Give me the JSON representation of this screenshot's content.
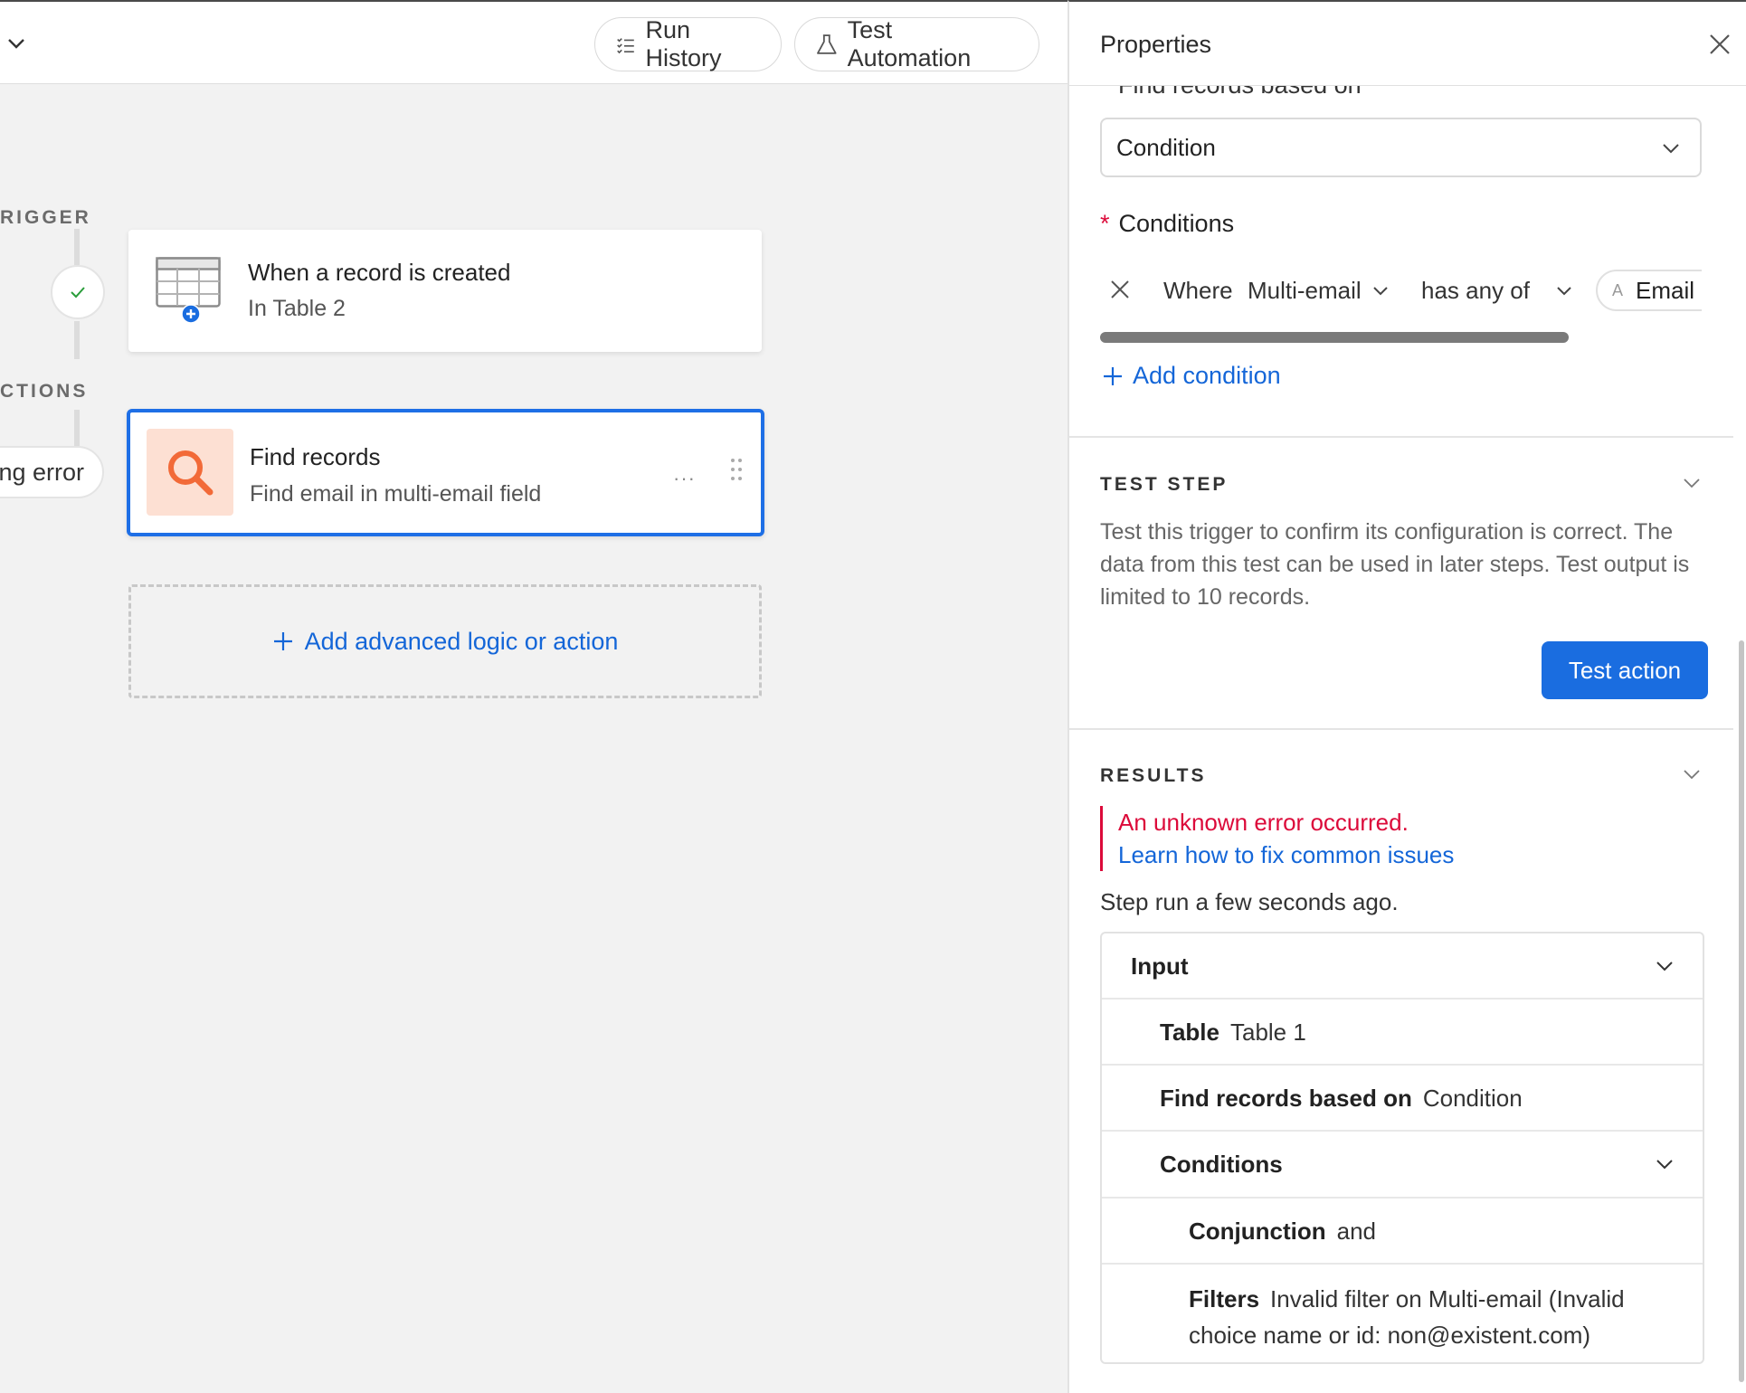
{
  "toolbar": {
    "run_history": "Run History",
    "test_automation": "Test Automation"
  },
  "canvas": {
    "trigger_label": "RIGGER",
    "actions_label": "CTIONS",
    "error_pill": "ng error",
    "trigger_card": {
      "title": "When a record is created",
      "subtitle": "In Table 2"
    },
    "action_card": {
      "title": "Find records",
      "subtitle": "Find email in multi-email field",
      "more": "···"
    },
    "add_action": "Add advanced logic or action"
  },
  "panel": {
    "title": "Properties",
    "cut_label": "Find records based on",
    "find_based_on_value": "Condition",
    "conditions_label": "Conditions",
    "required_mark": "*",
    "condition": {
      "where": "Where",
      "field": "Multi-email",
      "operator": "has any of",
      "value_type": "A",
      "value": "Email"
    },
    "add_condition": "Add condition",
    "test_step": {
      "heading": "TEST STEP",
      "description": "Test this trigger to confirm its configuration is correct. The data from this test can be used in later steps. Test output is limited to 10 records.",
      "button": "Test action"
    },
    "results": {
      "heading": "RESULTS",
      "error": "An unknown error occurred.",
      "help_link": "Learn how to fix common issues",
      "step_run": "Step run a few seconds ago.",
      "input_label": "Input",
      "table_key": "Table",
      "table_value": "Table 1",
      "based_on_key": "Find records based on",
      "based_on_value": "Condition",
      "conditions_key": "Conditions",
      "conjunction_key": "Conjunction",
      "conjunction_value": "and",
      "filters_key": "Filters",
      "filters_value": "Invalid filter on Multi-email (Invalid choice name or id: non@existent.com)"
    }
  },
  "colors": {
    "accent": "#1a6de0",
    "link": "#1466d8",
    "error": "#dc0a3a",
    "search_tile": "#fde0d3",
    "search_icon": "#f26a38"
  }
}
